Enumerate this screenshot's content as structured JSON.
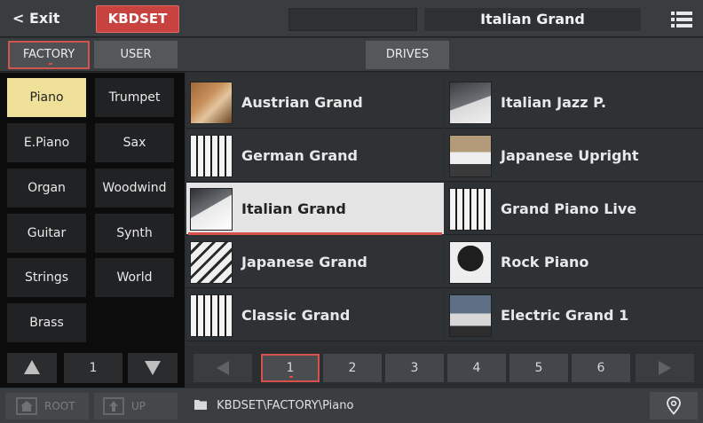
{
  "header": {
    "exit_label": "< Exit",
    "tab_label": "KBDSET",
    "title": "Italian Grand"
  },
  "subtabs": {
    "factory": "FACTORY",
    "user": "USER",
    "drives": "DRIVES"
  },
  "categories": [
    {
      "label": "Piano",
      "selected": true
    },
    {
      "label": "Trumpet"
    },
    {
      "label": "E.Piano"
    },
    {
      "label": "Sax"
    },
    {
      "label": "Organ"
    },
    {
      "label": "Woodwind"
    },
    {
      "label": "Guitar"
    },
    {
      "label": "Synth"
    },
    {
      "label": "Strings"
    },
    {
      "label": "World"
    },
    {
      "label": "Brass"
    }
  ],
  "category_page": "1",
  "sounds": [
    {
      "name": "Austrian Grand"
    },
    {
      "name": "Italian Jazz P."
    },
    {
      "name": "German Grand"
    },
    {
      "name": "Japanese Upright"
    },
    {
      "name": "Italian Grand",
      "selected": true
    },
    {
      "name": "Grand Piano Live"
    },
    {
      "name": "Japanese Grand"
    },
    {
      "name": "Rock Piano"
    },
    {
      "name": "Classic Grand"
    },
    {
      "name": "Electric Grand 1"
    }
  ],
  "pages": [
    "1",
    "2",
    "3",
    "4",
    "5",
    "6"
  ],
  "current_page": "1",
  "footer": {
    "root_label": "ROOT",
    "up_label": "UP",
    "path": "KBDSET\\FACTORY\\Piano"
  },
  "colors": {
    "accent": "#c8423f",
    "selected_category": "#efe09a",
    "selected_cell": "#e4e4e4"
  }
}
